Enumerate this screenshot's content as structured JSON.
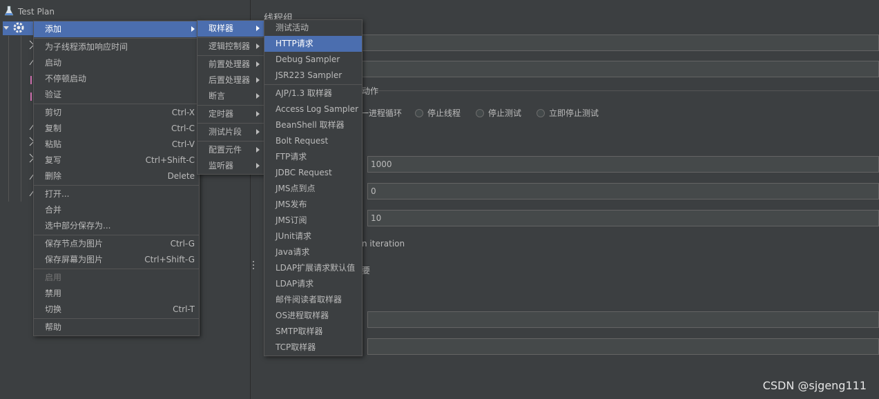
{
  "tree": {
    "root_label": "Test Plan"
  },
  "panel": {
    "title": "线程组",
    "action_group_label": "动作",
    "radios": [
      "一进程循环",
      "停止线程",
      "停止测试",
      "立即停止测试"
    ],
    "fields": {
      "threads": "1000",
      "ramp": "0",
      "loops": "10"
    },
    "iteration_text": "n iteration",
    "need_text": "要"
  },
  "context_menu": {
    "items": [
      {
        "label": "添加",
        "shortcut": "",
        "submenu": true,
        "active": true
      },
      {
        "sep": true
      },
      {
        "label": "为子线程添加响应时间",
        "shortcut": ""
      },
      {
        "label": "启动",
        "shortcut": ""
      },
      {
        "label": "不停顿启动",
        "shortcut": ""
      },
      {
        "label": "验证",
        "shortcut": ""
      },
      {
        "sep": true
      },
      {
        "label": "剪切",
        "shortcut": "Ctrl-X"
      },
      {
        "label": "复制",
        "shortcut": "Ctrl-C"
      },
      {
        "label": "粘贴",
        "shortcut": "Ctrl-V"
      },
      {
        "label": "复写",
        "shortcut": "Ctrl+Shift-C"
      },
      {
        "label": "删除",
        "shortcut": "Delete"
      },
      {
        "sep": true
      },
      {
        "label": "打开...",
        "shortcut": ""
      },
      {
        "label": "合并",
        "shortcut": ""
      },
      {
        "label": "选中部分保存为...",
        "shortcut": ""
      },
      {
        "sep": true
      },
      {
        "label": "保存节点为图片",
        "shortcut": "Ctrl-G"
      },
      {
        "label": "保存屏幕为图片",
        "shortcut": "Ctrl+Shift-G"
      },
      {
        "sep": true
      },
      {
        "label": "启用",
        "shortcut": "",
        "disabled": true
      },
      {
        "label": "禁用",
        "shortcut": ""
      },
      {
        "label": "切换",
        "shortcut": "Ctrl-T"
      },
      {
        "sep": true
      },
      {
        "label": "帮助",
        "shortcut": ""
      }
    ]
  },
  "add_menu": {
    "items": [
      {
        "label": "取样器",
        "active": true
      },
      {
        "sep": true
      },
      {
        "label": "逻辑控制器"
      },
      {
        "sep": true
      },
      {
        "label": "前置处理器"
      },
      {
        "label": "后置处理器"
      },
      {
        "label": "断言"
      },
      {
        "sep": true
      },
      {
        "label": "定时器"
      },
      {
        "sep": true
      },
      {
        "label": "测试片段"
      },
      {
        "sep": true
      },
      {
        "label": "配置元件"
      },
      {
        "label": "监听器"
      }
    ]
  },
  "sampler_menu": {
    "items": [
      {
        "label": "测试活动"
      },
      {
        "label": "HTTP请求",
        "active": true
      },
      {
        "label": "Debug Sampler"
      },
      {
        "label": "JSR223 Sampler"
      },
      {
        "sep": true
      },
      {
        "label": "AJP/1.3 取样器"
      },
      {
        "label": "Access Log Sampler"
      },
      {
        "label": "BeanShell 取样器"
      },
      {
        "label": "Bolt Request"
      },
      {
        "label": "FTP请求"
      },
      {
        "label": "JDBC Request"
      },
      {
        "label": "JMS点到点"
      },
      {
        "label": "JMS发布"
      },
      {
        "label": "JMS订阅"
      },
      {
        "label": "JUnit请求"
      },
      {
        "label": "Java请求"
      },
      {
        "label": "LDAP扩展请求默认值"
      },
      {
        "label": "LDAP请求"
      },
      {
        "label": "邮件阅读者取样器"
      },
      {
        "label": "OS进程取样器"
      },
      {
        "label": "SMTP取样器"
      },
      {
        "label": "TCP取样器"
      }
    ]
  },
  "watermark": "CSDN @sjgeng111",
  "colors": {
    "background": "#3c3f41",
    "highlight": "#4b6eaf",
    "text": "#bbbbbb"
  }
}
